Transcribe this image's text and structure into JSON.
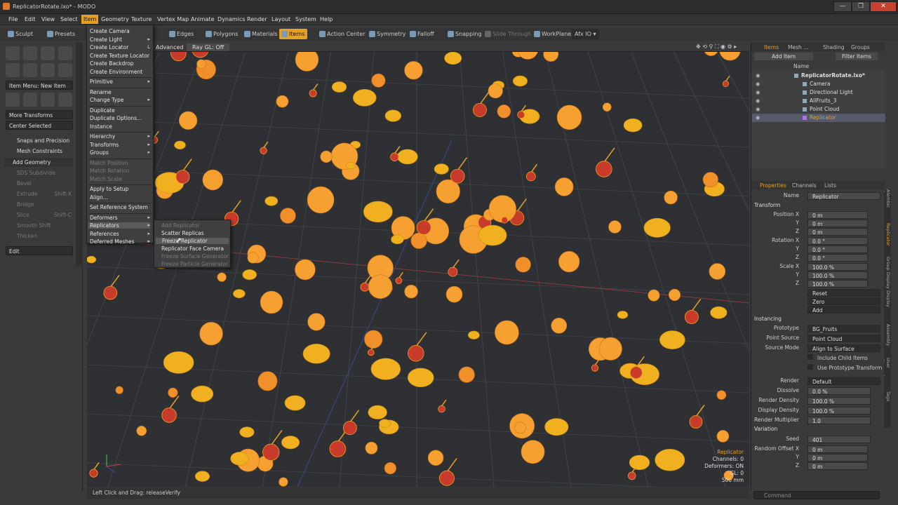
{
  "window": {
    "title": "ReplicatorRotate.lxo* - MODO",
    "buttons": [
      "—",
      "❐",
      "✕"
    ]
  },
  "menubar": [
    "File",
    "Edit",
    "View",
    "Select",
    "Item",
    "Geometry",
    "Texture",
    "Vertex Map",
    "Animate",
    "Dynamics",
    "Render",
    "Layout",
    "System",
    "Help"
  ],
  "toolbar": {
    "sculpt": "Sculpt",
    "presets": "Presets",
    "edges": "Edges",
    "polygons": "Polygons",
    "materials": "Materials",
    "items": "Items",
    "action_center": "Action Center",
    "symmetry": "Symmetry",
    "falloff": "Falloff",
    "snapping": "Snapping",
    "slide_through": "Slide Through",
    "workplane": "WorkPlane",
    "afx": "Afx IO"
  },
  "left": {
    "item_menu": "Item Menu: New Item",
    "more_transforms": "More Transforms",
    "center_selected": "Center Selected",
    "snaps": "Snaps and Precision",
    "mesh_constraints": "Mesh Constraints",
    "add_geometry": "Add Geometry",
    "geo_items": [
      "SDS Subdivide",
      "Bevel",
      "Extrude",
      "Bridge",
      "Slice",
      "Smooth Shift",
      "Thicken"
    ],
    "geo_keys": [
      "",
      "",
      "Shift-X",
      "",
      "Shift-C",
      "",
      ""
    ],
    "edit": "Edit"
  },
  "item_menu": {
    "items": [
      {
        "label": "Create Camera",
        "dis": false,
        "sub": false
      },
      {
        "label": "Create Light",
        "dis": false,
        "sub": true
      },
      {
        "label": "Create Locator",
        "dis": false,
        "sub": false,
        "key": "L"
      },
      {
        "label": "Create Texture Locator",
        "dis": false,
        "sub": false
      },
      {
        "label": "Create Backdrop",
        "dis": false,
        "sub": false
      },
      {
        "label": "Create Environment",
        "dis": false,
        "sub": false
      },
      {
        "label": "Primitive",
        "dis": false,
        "sub": true
      },
      {
        "label": "Rename",
        "dis": false,
        "sub": false
      },
      {
        "label": "Change Type",
        "dis": false,
        "sub": true
      },
      {
        "label": "Duplicate",
        "dis": false,
        "sub": false
      },
      {
        "label": "Duplicate Options...",
        "dis": false,
        "sub": false
      },
      {
        "label": "Instance",
        "dis": false,
        "sub": false
      },
      {
        "label": "Hierarchy",
        "dis": false,
        "sub": true
      },
      {
        "label": "Transforms",
        "dis": false,
        "sub": true
      },
      {
        "label": "Groups",
        "dis": false,
        "sub": true
      },
      {
        "label": "Match Position",
        "dis": true,
        "sub": false
      },
      {
        "label": "Match Rotation",
        "dis": true,
        "sub": false
      },
      {
        "label": "Match Scale",
        "dis": true,
        "sub": false
      },
      {
        "label": "Apply to Setup",
        "dis": false,
        "sub": false
      },
      {
        "label": "Align...",
        "dis": false,
        "sub": false
      },
      {
        "label": "Set Reference System",
        "dis": false,
        "sub": false
      },
      {
        "label": "Deformers",
        "dis": false,
        "sub": true
      },
      {
        "label": "Replicators",
        "dis": false,
        "sub": true
      },
      {
        "label": "References",
        "dis": false,
        "sub": true
      },
      {
        "label": "Deferred Meshes",
        "dis": false,
        "sub": true
      }
    ]
  },
  "replicators_menu": [
    {
      "label": "Add Replicator",
      "dis": true
    },
    {
      "label": "Scatter Replicas",
      "dis": false
    },
    {
      "label": "Freeze Replicator",
      "dis": false
    },
    {
      "label": "Replicator Face Camera",
      "dis": false
    },
    {
      "label": "Freeze Surface Generator",
      "dis": true
    },
    {
      "label": "Freeze Particle Generator",
      "dis": true
    }
  ],
  "viewport": {
    "mode": "Advanced",
    "raygl": "Ray GL: Off",
    "info": [
      "Replicator",
      "Channels: 0",
      "Deformers: ON",
      "GL: 0",
      "500 mm"
    ]
  },
  "status": "Left Click and Drag:  releaseVerify",
  "command_placeholder": "Command",
  "items_panel": {
    "tabs": [
      "Items",
      "Mesh ...",
      "Shading",
      "Groups"
    ],
    "add_item": "Add Item",
    "filter": "Filter Items",
    "col_name": "Name",
    "tree": [
      {
        "name": "ReplicatorRotate.lxo*",
        "indent": 0,
        "sel": false
      },
      {
        "name": "Camera",
        "indent": 2,
        "sel": false
      },
      {
        "name": "Directional Light",
        "indent": 2,
        "sel": false
      },
      {
        "name": "AllFruits_3",
        "indent": 2,
        "sel": false
      },
      {
        "name": "Point Cloud",
        "indent": 2,
        "sel": false
      },
      {
        "name": "Replicator",
        "indent": 2,
        "sel": true
      }
    ]
  },
  "properties": {
    "tabs": [
      "Properties",
      "Channels",
      "Lists"
    ],
    "name_label": "Name",
    "name": "Replicator",
    "transform": "Transform",
    "position_label": "Position X",
    "rotation_label": "Rotation X",
    "scale_label": "Scale X",
    "y": "Y",
    "z": "Z",
    "position": [
      "0 m",
      "0 m",
      "0 m"
    ],
    "rotation": [
      "0.0 °",
      "0.0 °",
      "0.0 °"
    ],
    "scale": [
      "100.0 %",
      "100.0 %",
      "100.0 %"
    ],
    "reset": "Reset",
    "zero": "Zero",
    "add": "Add",
    "instancing": "Instancing",
    "prototype_label": "Prototype",
    "prototype": "BG_Fruits",
    "point_source_label": "Point Source",
    "point_source": "Point Cloud",
    "source_mode_label": "Source Mode",
    "source_mode": "Align to Surface",
    "include_child": "Include Child Items",
    "use_proto": "Use Prototype Transform",
    "render_label": "Render",
    "render": "Default",
    "dissolve_label": "Dissolve",
    "dissolve": "0.0 %",
    "render_density_label": "Render Density",
    "render_density": "100.0 %",
    "display_density_label": "Display Density",
    "display_density": "100.0 %",
    "render_mult_label": "Render Multiplier",
    "render_mult": "1.0",
    "variation": "Variation",
    "seed_label": "Seed",
    "seed": "401",
    "random_offset_label": "Random Offset X",
    "random_offset": [
      "0 m",
      "0 m",
      "0 m"
    ]
  },
  "side_tabs": [
    "Alembic Curves",
    "Replicator",
    "Group Display",
    "Display",
    "Assembly",
    "User Channels",
    "Tags"
  ],
  "colors": {
    "accent": "#e8a020",
    "lemon": "#f0b020",
    "orange": "#f5a030",
    "cherry": "#c83a2a",
    "leaf": "#c8a030"
  }
}
